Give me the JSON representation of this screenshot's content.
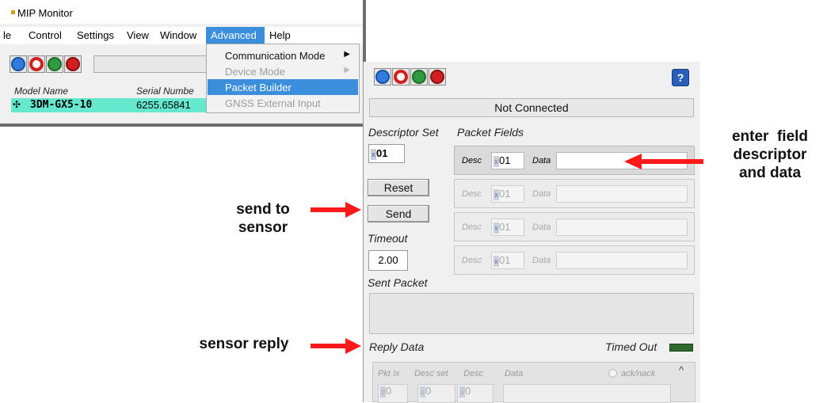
{
  "inset": {
    "window_title": "MIP Monitor",
    "menu": [
      "le",
      "Control",
      "Settings",
      "View",
      "Window",
      "Advanced",
      "Help"
    ],
    "dropdown": [
      {
        "label": "Communication Mode",
        "submenu": true,
        "enabled": true
      },
      {
        "label": "Device Mode",
        "submenu": true,
        "enabled": false
      },
      {
        "label": "Packet Builder",
        "submenu": false,
        "enabled": true,
        "highlighted": true
      },
      {
        "label": "GNSS External Input",
        "submenu": false,
        "enabled": false
      }
    ],
    "table": {
      "headers": [
        "Model Name",
        "Serial Numbe"
      ],
      "row": {
        "model": "3DM-GX5-10",
        "serial": "6255.65841"
      }
    }
  },
  "packet_builder": {
    "help": "?",
    "status": "Not Connected",
    "descriptor_set_label": "Descriptor Set",
    "descriptor_set_value": "01",
    "packet_fields_label": "Packet Fields",
    "field_desc_label": "Desc",
    "field_data_label": "Data",
    "fields": [
      {
        "desc": "01",
        "data": ""
      },
      {
        "desc": "01",
        "data": ""
      },
      {
        "desc": "01",
        "data": ""
      },
      {
        "desc": "01",
        "data": ""
      }
    ],
    "reset_label": "Reset",
    "send_label": "Send",
    "timeout_label": "Timeout",
    "timeout_value": "2.00",
    "sent_packet_label": "Sent Packet",
    "reply_data_label": "Reply Data",
    "timed_out_label": "Timed Out",
    "reply_headers": {
      "pkt_ix": "Pkt Ix",
      "desc_set": "Desc set",
      "desc": "Desc",
      "data": "Data",
      "ack": "ack/nack"
    },
    "reply_values": {
      "pkt_ix": "0",
      "desc_set": "0",
      "desc": "0"
    }
  },
  "annotations": {
    "send": "send to sensor",
    "send_lines": [
      "send to",
      "sensor"
    ],
    "reply": "sensor reply",
    "enter": "enter field descriptor and data",
    "enter_lines": [
      "enter  field",
      "descriptor",
      "and data"
    ]
  },
  "colors": {
    "arrow": "#ff1a1a",
    "menu_highlight": "#3b8edc",
    "row_highlight": "#66e8cf"
  }
}
